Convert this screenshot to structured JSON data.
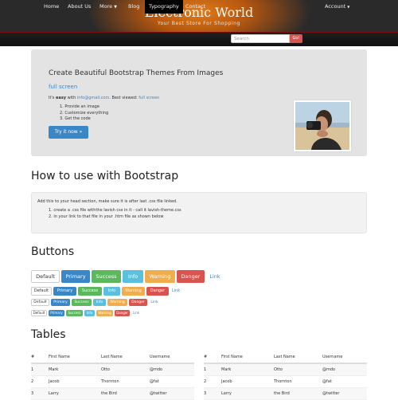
{
  "header": {
    "title": "Electronic World",
    "subtitle": "Your Best Store For Shopping"
  },
  "nav": {
    "items": [
      "Home",
      "About Us",
      "More",
      "Blog",
      "Typography",
      "Contact"
    ],
    "search_placeholder": "Search",
    "go_label": "Go!",
    "account_label": "Account"
  },
  "jumbotron": {
    "title": "Create Beautiful Bootstrap Themes From Images",
    "link": "full screen",
    "text_prefix": "It's",
    "text_easy": "easy",
    "text_with": "with",
    "email": "info@gmail.com",
    "text_best": ". Best viewed:",
    "best_link": "full screen",
    "steps": [
      "Provide an image",
      "Customize everything",
      "Get the code"
    ],
    "button": "Try it now »"
  },
  "howto": {
    "heading": "How to use with Bootstrap",
    "text": "Add this to your head section, make sure it is after last .css file linked.",
    "steps": [
      "create a .css file withthe lavish css in it - call it lavish-theme.css",
      "in your link to that file in your .htm file as shown below"
    ]
  },
  "buttons": {
    "heading": "Buttons",
    "labels": [
      "Default",
      "Primary",
      "Success",
      "Info",
      "Warning",
      "Danger",
      "Link"
    ]
  },
  "tables": {
    "heading": "Tables",
    "columns": [
      "#",
      "First Name",
      "Last Name",
      "Username"
    ],
    "rows": [
      [
        "1",
        "Mark",
        "Otto",
        "@mdo"
      ],
      [
        "2",
        "Jacob",
        "Thornton",
        "@fat"
      ],
      [
        "3",
        "Larry",
        "the Bird",
        "@twitter"
      ]
    ]
  },
  "colors": {
    "primary": "#3a87c8",
    "success": "#5cb85c",
    "info": "#5bc0de",
    "warning": "#f0ad4e",
    "danger": "#d9534f"
  }
}
